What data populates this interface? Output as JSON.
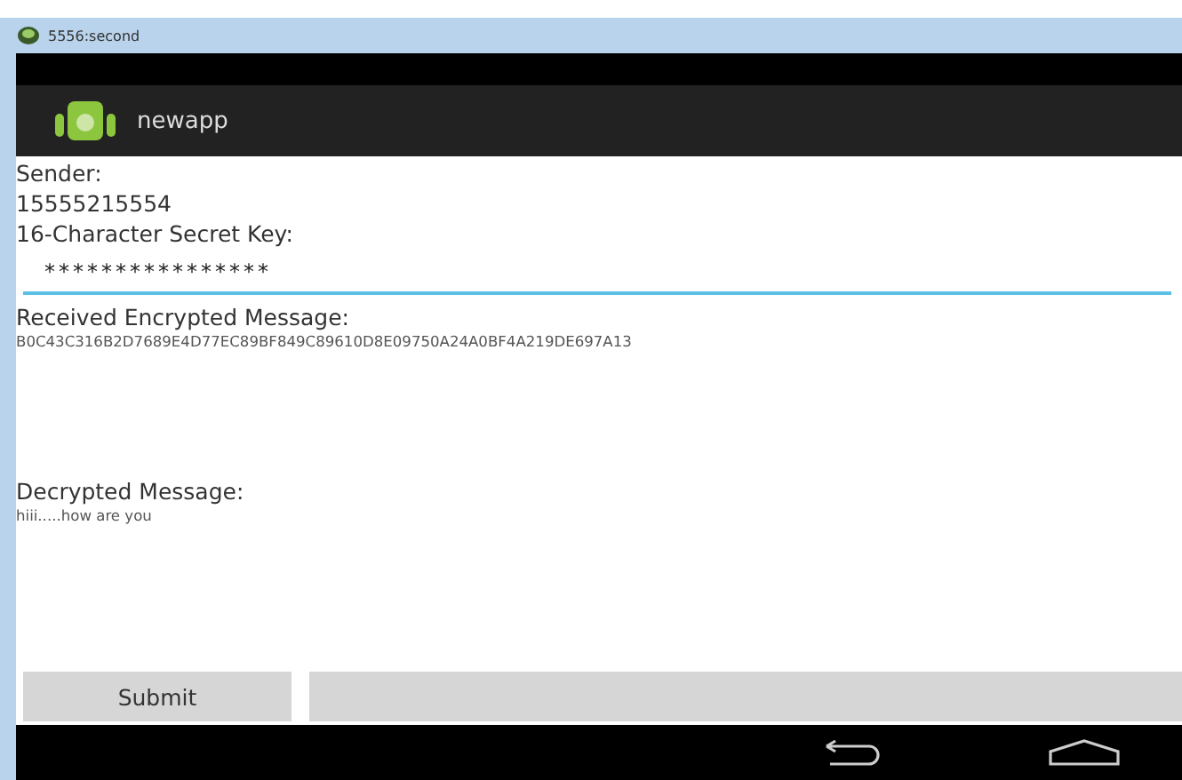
{
  "window": {
    "title": "5556:second"
  },
  "action_bar": {
    "title": "newapp"
  },
  "sender": {
    "label": "Sender:",
    "value": "15555215554"
  },
  "secret_key": {
    "label": "16-Character Secret Key:",
    "value": "****************"
  },
  "encrypted": {
    "label": "Received Encrypted Message:",
    "value": "B0C43C316B2D7689E4D77EC89BF849C89610D8E09750A24A0BF4A219DE697A13"
  },
  "decrypted": {
    "label": "Decrypted Message:",
    "value": "hiii.....how are you"
  },
  "buttons": [
    {
      "kind": "labeled",
      "label": "Submit"
    },
    {
      "kind": "blank"
    }
  ]
}
